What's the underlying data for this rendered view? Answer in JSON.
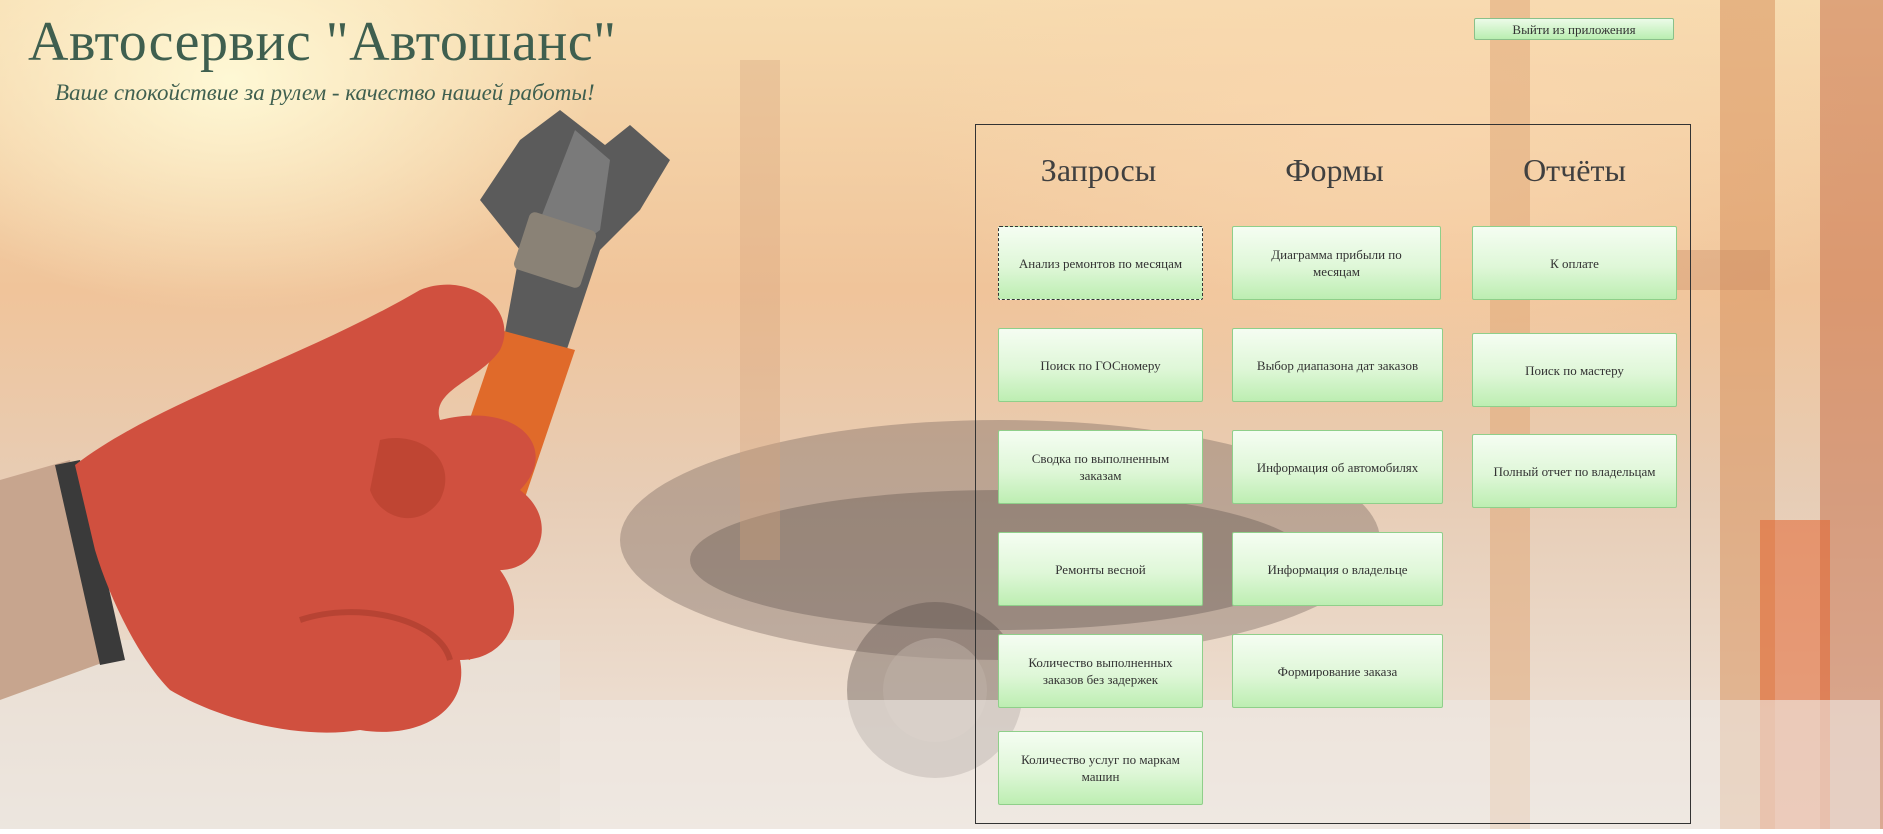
{
  "app": {
    "title": "Автосервис \"Автошанс\"",
    "slogan": "Ваше спокойствие за рулем - качество нашей работы!",
    "exit_label": "Выйти из приложения"
  },
  "columns": {
    "queries": {
      "heading": "Запросы",
      "buttons": [
        "Анализ ремонтов по месяцам",
        "Поиск по ГОСномеру",
        "Сводка по выполненным заказам",
        "Ремонты весной",
        "Количество выполненных заказов без задержек",
        "Количество услуг по маркам машин"
      ]
    },
    "forms": {
      "heading": "Формы",
      "buttons": [
        "Диаграмма прибыли по месяцам",
        "Выбор диапазона дат заказов",
        "Информация об автомобилях",
        "Информация о владельце",
        "Формирование заказа"
      ]
    },
    "reports": {
      "heading": "Отчёты",
      "buttons": [
        "К оплате",
        "Поиск по мастеру",
        "Полный отчет по владельцам"
      ]
    }
  },
  "colors": {
    "title": "#3f5f4f",
    "button_gradient_bottom": "#bdeeb2",
    "glove": "#d0503f",
    "wrench_handle": "#e06a2a"
  },
  "icons": {
    "hero_image": "hand-with-wrench-image"
  }
}
